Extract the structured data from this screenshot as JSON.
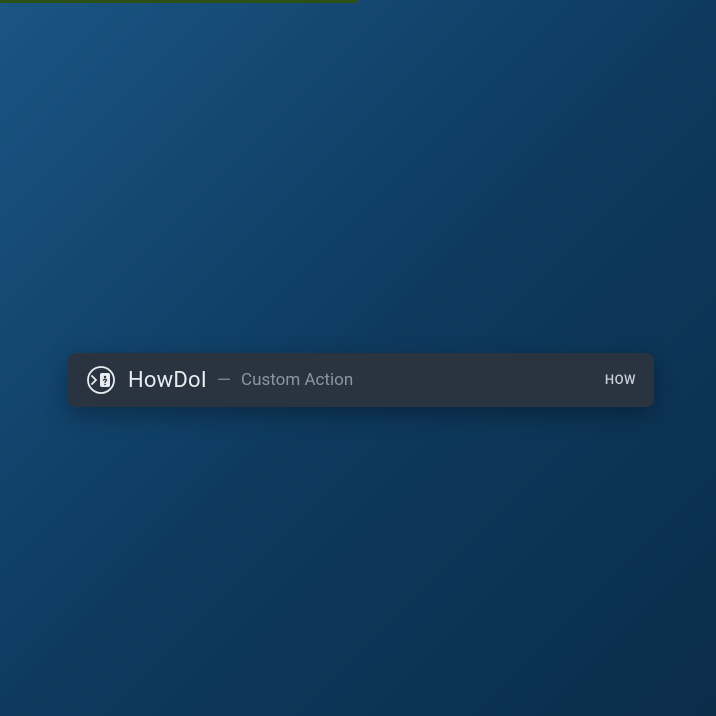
{
  "command_bar": {
    "icon_name": "prompt-question-icon",
    "title": "HowDoI",
    "separator": "—",
    "subtitle": "Custom Action",
    "badge": "HOW"
  }
}
